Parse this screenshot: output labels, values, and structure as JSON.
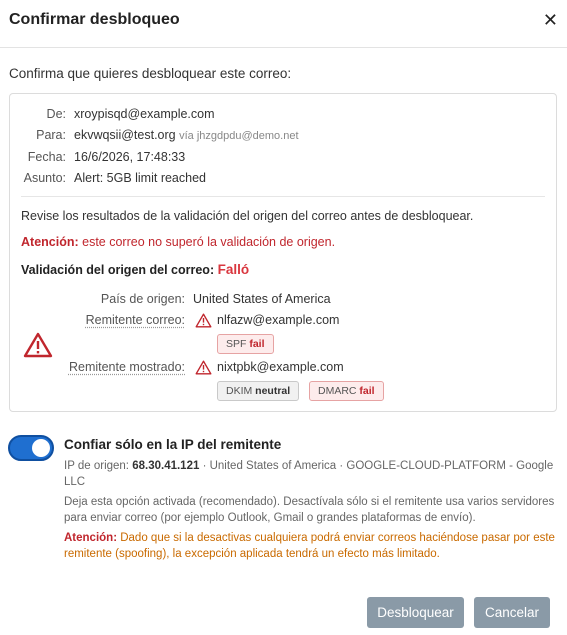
{
  "dialog": {
    "title": "Confirmar desbloqueo",
    "close_glyph": "✕",
    "close_icon": "close-icon",
    "intro": "Confirma que quieres desbloquear este correo:"
  },
  "headers": {
    "from_label": "De:",
    "from_value": "xroypisqd@example.com",
    "to_label": "Para:",
    "to_value": "ekvwqsii@test.org",
    "to_via": "vía jhzgdpdu@demo.net",
    "date_label": "Fecha:",
    "date_value": "16/6/2026, 17:48:33",
    "subject_label": "Asunto:",
    "subject_value": "Alert: 5GB limit reached"
  },
  "validation": {
    "review_note": "Revise los resultados de la validación del origen del correo antes de desbloquear.",
    "attention_label": "Atención:",
    "attention_text": "este correo no superó la validación de origen.",
    "title_label": "Validación del origen del correo:",
    "title_status": "Falló",
    "country_label": "País de origen:",
    "country_value": "United States of America",
    "sender_label": "Remitente correo:",
    "sender_value": "nlfazw@example.com",
    "shown_label": "Remitente mostrado:",
    "shown_value": "nixtpbk@example.com",
    "badges": {
      "spf_name": "SPF",
      "spf_result": "fail",
      "dkim_name": "DKIM",
      "dkim_result": "neutral",
      "dmarc_name": "DMARC",
      "dmarc_result": "fail"
    },
    "alert_icon": "warning-triangle-icon",
    "colors": {
      "fail": "#c0262d",
      "warning_icon": "#c0262d"
    }
  },
  "option": {
    "enabled": true,
    "title": "Confiar sólo en la IP del remitente",
    "ip_label": "IP de origen:",
    "ip_value": "68.30.41.121",
    "ip_info": "· United States of America · GOOGLE-CLOUD-PLATFORM - Google LLC",
    "description": "Deja esta opción activada (recomendado). Desactívala sólo si el remitente usa varios servidores para enviar correo (por ejemplo Outlook, Gmail o grandes plataformas de envío).",
    "warn_label": "Atención:",
    "warn_text": "Dado que si la desactivas cualquiera podrá enviar correos haciéndose pasar por este remitente (spoofing), la excepción aplicada tendrá un efecto más limitado.",
    "toggle_color": "#1f6fd0"
  },
  "buttons": {
    "unblock_label": "Desbloquear",
    "cancel_label": "Cancelar",
    "button_color": "#8a9aa7"
  }
}
